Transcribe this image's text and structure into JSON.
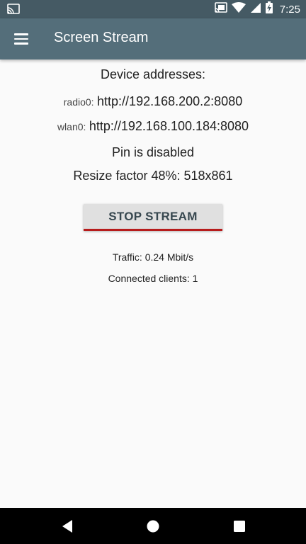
{
  "status_bar": {
    "time": "7:25",
    "icons": [
      "cast-icon",
      "cast-connected-icon",
      "wifi-icon",
      "signal-icon",
      "battery-charging-icon"
    ]
  },
  "app_bar": {
    "title": "Screen Stream",
    "menu_icon": "menu-icon",
    "background": "#546e7a",
    "status_background": "#455a64"
  },
  "main": {
    "addresses_title": "Device addresses:",
    "addresses": [
      {
        "interface": "radio0:",
        "url": "http://192.168.200.2:8080"
      },
      {
        "interface": "wlan0:",
        "url": "http://192.168.100.184:8080"
      }
    ],
    "pin_status": "Pin is disabled",
    "resize_info": "Resize factor 48%: 518x861",
    "stop_button_label": "STOP STREAM",
    "traffic": "Traffic: 0.24 Mbit/s",
    "connected_clients": "Connected clients: 1",
    "accent_color": "#b71c1c"
  },
  "nav_bar": {
    "buttons": [
      "back-icon",
      "home-icon",
      "recents-icon"
    ]
  }
}
